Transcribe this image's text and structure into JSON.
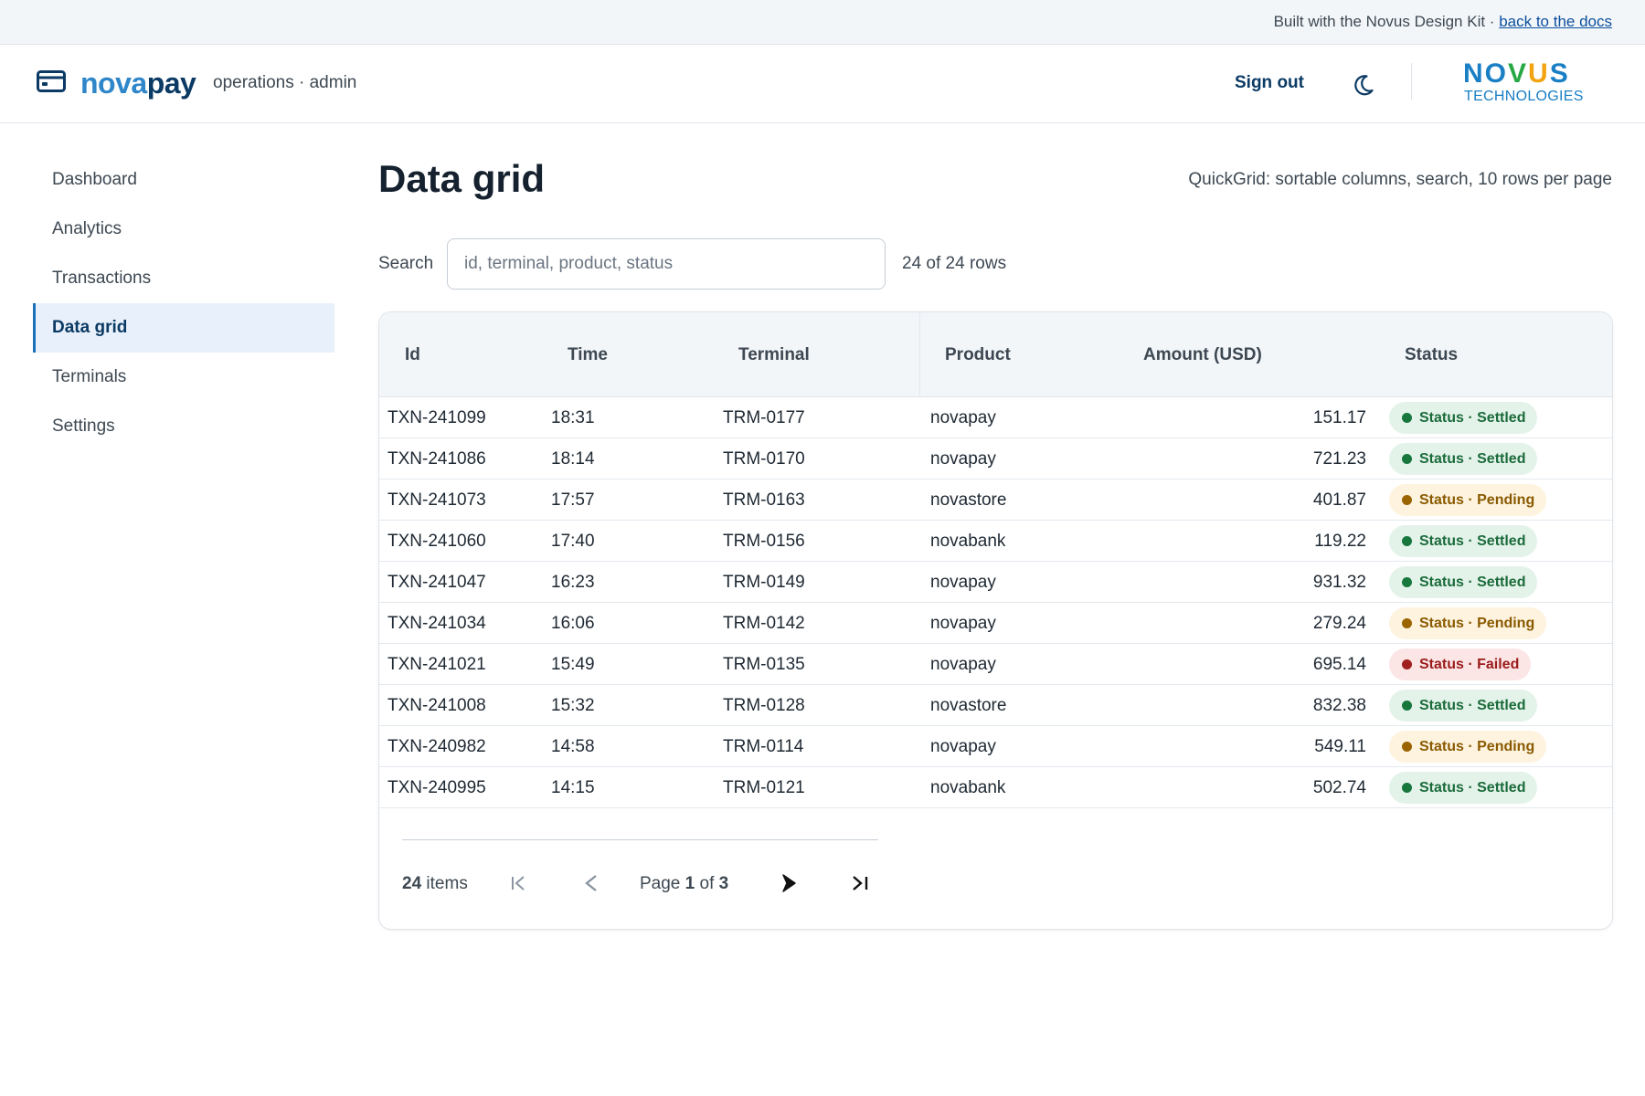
{
  "banner": {
    "text": "Built with the Novus Design Kit · ",
    "link": "back to the docs"
  },
  "header": {
    "brand_part1": "nova",
    "brand_part2": "pay",
    "subtitle": "operations · admin",
    "sign_out": "Sign out",
    "theme_icon": "moon-icon",
    "company_name": "NOVUS",
    "company_sub": "TECHNOLOGIES",
    "company_colors": [
      "#1a7fc4",
      "#1a7fc4",
      "#27a844",
      "#f2a30f",
      "#1a7fc4"
    ]
  },
  "sidebar": {
    "items": [
      {
        "label": "Dashboard",
        "active": false
      },
      {
        "label": "Analytics",
        "active": false
      },
      {
        "label": "Transactions",
        "active": false
      },
      {
        "label": "Data grid",
        "active": true
      },
      {
        "label": "Terminals",
        "active": false
      },
      {
        "label": "Settings",
        "active": false
      }
    ]
  },
  "main": {
    "title": "Data grid",
    "description": "QuickGrid: sortable columns, search, 10 rows per page",
    "search": {
      "label": "Search",
      "placeholder": "id, terminal, product, status",
      "value": ""
    },
    "row_count": "24 of 24 rows",
    "columns": [
      "Id",
      "Time",
      "Terminal",
      "Product",
      "Amount (USD)",
      "Status"
    ],
    "rows": [
      {
        "id": "TXN-241099",
        "time": "18:31",
        "terminal": "TRM-0177",
        "product": "novapay",
        "amount": "151.17",
        "status": "Status · Settled",
        "kind": "settled"
      },
      {
        "id": "TXN-241086",
        "time": "18:14",
        "terminal": "TRM-0170",
        "product": "novapay",
        "amount": "721.23",
        "status": "Status · Settled",
        "kind": "settled"
      },
      {
        "id": "TXN-241073",
        "time": "17:57",
        "terminal": "TRM-0163",
        "product": "novastore",
        "amount": "401.87",
        "status": "Status · Pending",
        "kind": "pending"
      },
      {
        "id": "TXN-241060",
        "time": "17:40",
        "terminal": "TRM-0156",
        "product": "novabank",
        "amount": "119.22",
        "status": "Status · Settled",
        "kind": "settled"
      },
      {
        "id": "TXN-241047",
        "time": "16:23",
        "terminal": "TRM-0149",
        "product": "novapay",
        "amount": "931.32",
        "status": "Status · Settled",
        "kind": "settled"
      },
      {
        "id": "TXN-241034",
        "time": "16:06",
        "terminal": "TRM-0142",
        "product": "novapay",
        "amount": "279.24",
        "status": "Status · Pending",
        "kind": "pending"
      },
      {
        "id": "TXN-241021",
        "time": "15:49",
        "terminal": "TRM-0135",
        "product": "novapay",
        "amount": "695.14",
        "status": "Status · Failed",
        "kind": "failed"
      },
      {
        "id": "TXN-241008",
        "time": "15:32",
        "terminal": "TRM-0128",
        "product": "novastore",
        "amount": "832.38",
        "status": "Status · Settled",
        "kind": "settled"
      },
      {
        "id": "TXN-240982",
        "time": "14:58",
        "terminal": "TRM-0114",
        "product": "novapay",
        "amount": "549.11",
        "status": "Status · Pending",
        "kind": "pending"
      },
      {
        "id": "TXN-240995",
        "time": "14:15",
        "terminal": "TRM-0121",
        "product": "novabank",
        "amount": "502.74",
        "status": "Status · Settled",
        "kind": "settled"
      }
    ],
    "pager": {
      "total": "24",
      "items_label": " items",
      "page_prefix": "Page ",
      "current": "1",
      "of_label": " of ",
      "pages": "3"
    }
  }
}
